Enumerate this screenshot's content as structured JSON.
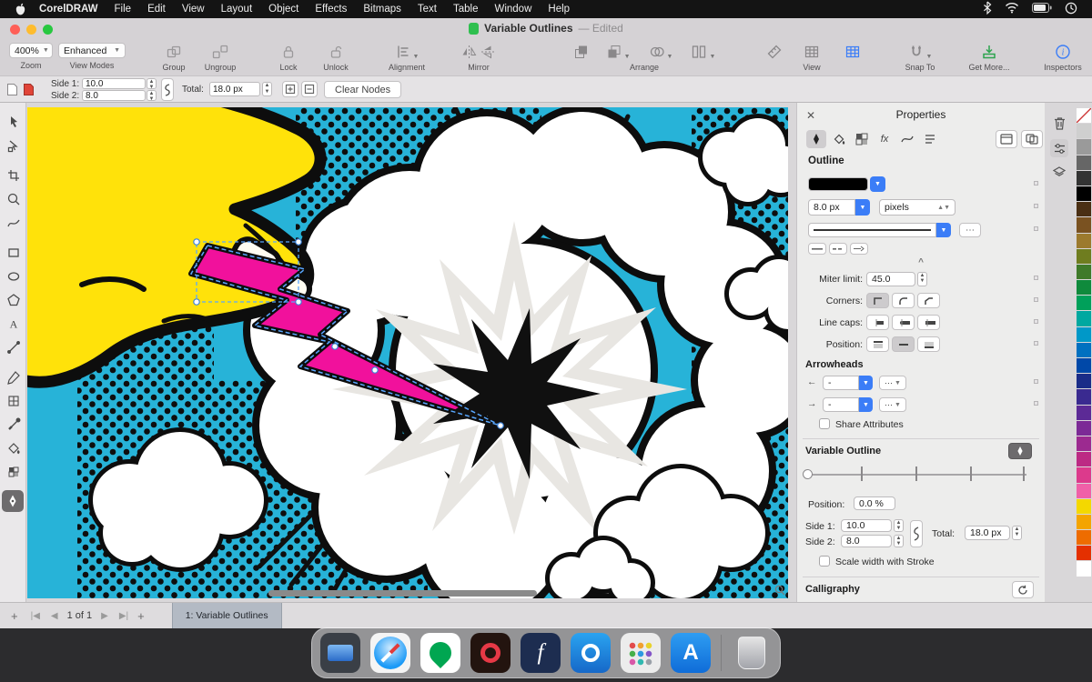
{
  "menubar": {
    "app_name": "CorelDRAW",
    "items": [
      "File",
      "Edit",
      "View",
      "Layout",
      "Object",
      "Effects",
      "Bitmaps",
      "Text",
      "Table",
      "Window",
      "Help"
    ]
  },
  "titlebar": {
    "title": "Variable Outlines",
    "edited": "—  Edited"
  },
  "toolbar": {
    "zoom": {
      "value": "400%",
      "label": "Zoom"
    },
    "view_modes": {
      "value": "Enhanced",
      "label": "View Modes"
    },
    "group_label": "Group",
    "ungroup_label": "Ungroup",
    "lock_label": "Lock",
    "unlock_label": "Unlock",
    "alignment_label": "Alignment",
    "mirror_label": "Mirror",
    "arrange_label": "Arrange",
    "view_label": "View",
    "snap_to_label": "Snap To",
    "get_more_label": "Get More...",
    "inspectors_label": "Inspectors"
  },
  "propbar": {
    "side1_label": "Side 1:",
    "side1_value": "10.0",
    "side2_label": "Side 2:",
    "side2_value": "8.0",
    "total_label": "Total:",
    "total_value": "18.0 px",
    "clear_nodes_label": "Clear Nodes"
  },
  "panel": {
    "title": "Properties",
    "outline_section": "Outline",
    "fx_icon": "fx",
    "width_value": "8.0 px",
    "units_value": "pixels",
    "miter_label": "Miter limit:",
    "miter_value": "45.0",
    "corners_label": "Corners:",
    "line_caps_label": "Line caps:",
    "position_label": "Position:",
    "arrowheads_section": "Arrowheads",
    "arrow_start_value": "-",
    "arrow_end_value": "-",
    "share_attributes_label": "Share Attributes",
    "variable_outline_section": "Variable Outline",
    "vo_position_label": "Position:",
    "vo_position_value": "0.0 %",
    "vo_side1_label": "Side 1:",
    "vo_side1_value": "10.0",
    "vo_side2_label": "Side 2:",
    "vo_side2_value": "8.0",
    "vo_total_label": "Total:",
    "vo_total_value": "18.0 px",
    "scale_width_label": "Scale width with Stroke",
    "calligraphy_section": "Calligraphy"
  },
  "pagebar": {
    "page_info": "1 of 1",
    "page_tab": "1: Variable Outlines"
  },
  "canvas": {
    "colors": {
      "bg": "#27b3d8",
      "hand": "#ffe20a",
      "bolt": "#f1119c",
      "ink": "#101010",
      "cloud": "#ffffff"
    }
  },
  "palette": {
    "colors": [
      "#ffffff",
      "#cfcfcf",
      "#9a9a9a",
      "#666666",
      "#333333",
      "#000000",
      "#4a2f14",
      "#7a5221",
      "#9c7a2e",
      "#6f7d1f",
      "#3f7a2a",
      "#0f8a3c",
      "#00a05a",
      "#00a8a0",
      "#0098c8",
      "#0070c0",
      "#0048a8",
      "#1a2c88",
      "#3a2a90",
      "#5c2a96",
      "#7c2a96",
      "#9c2a90",
      "#bc2a84",
      "#dc3a8c",
      "#f060a8",
      "#f4d800",
      "#f4a400",
      "#ee6c00",
      "#e43000",
      "#ffffff"
    ]
  },
  "dock": {
    "apps": [
      "Display",
      "Safari",
      "CorelDRAW",
      "Photo-Paint",
      "Font Manager",
      "Connect",
      "Launchpad",
      "App Store",
      "Trash"
    ]
  }
}
